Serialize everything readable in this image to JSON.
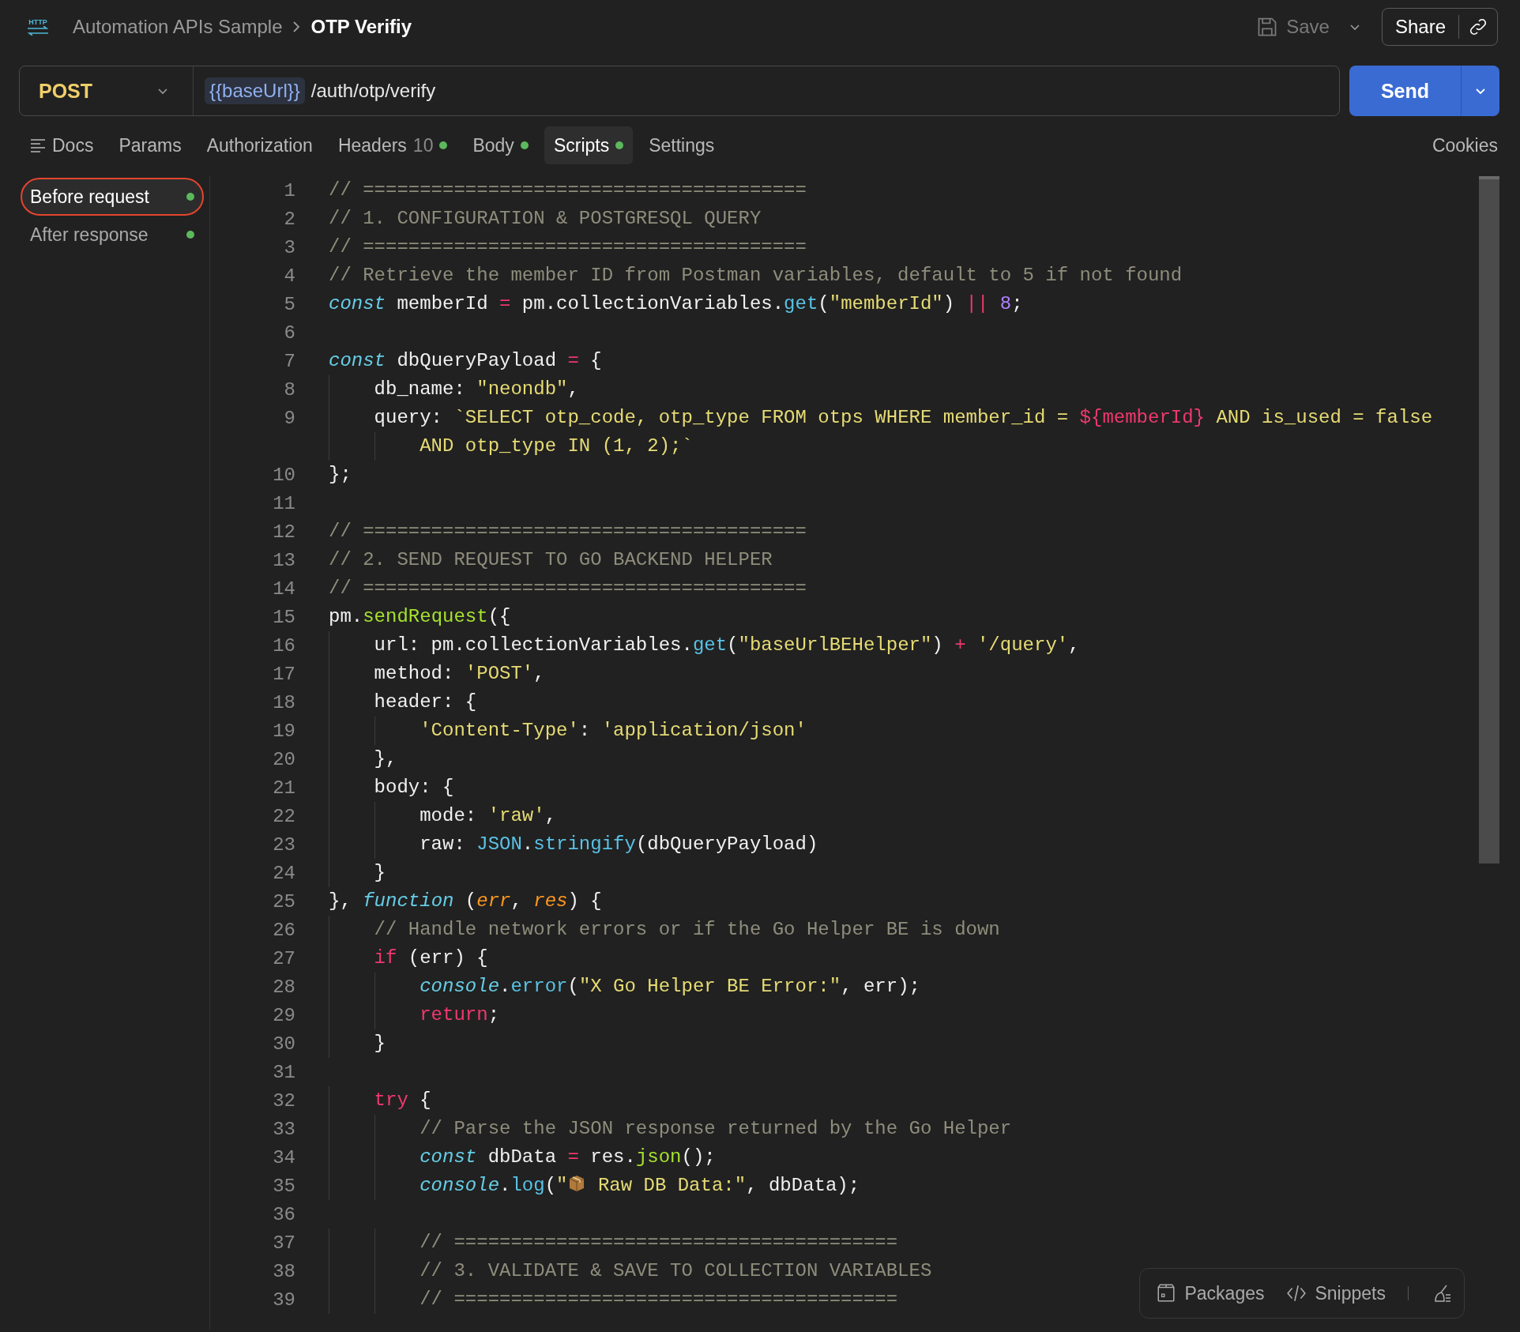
{
  "header": {
    "icon_label": "HTTP",
    "breadcrumb": [
      {
        "label": "Automation APIs Sample",
        "current": false
      },
      {
        "label": "OTP Verifiy",
        "current": true
      }
    ],
    "save": {
      "label": "Save",
      "disabled": true
    },
    "share": {
      "label": "Share"
    }
  },
  "request": {
    "method": "POST",
    "variable": "{{baseUrl}}",
    "path": "/auth/otp/verify",
    "send": "Send"
  },
  "tabs": [
    {
      "label": "Docs",
      "kind": "docs",
      "selected": false,
      "dot": false
    },
    {
      "label": "Params",
      "kind": "plain",
      "selected": false,
      "dot": false
    },
    {
      "label": "Authorization",
      "kind": "plain",
      "selected": false,
      "dot": false
    },
    {
      "label": "Headers",
      "kind": "plain",
      "count": "10",
      "selected": false,
      "dot": true
    },
    {
      "label": "Body",
      "kind": "plain",
      "selected": false,
      "dot": true
    },
    {
      "label": "Scripts",
      "kind": "plain",
      "selected": true,
      "dot": true
    },
    {
      "label": "Settings",
      "kind": "plain",
      "selected": false,
      "dot": false
    }
  ],
  "cookies": "Cookies",
  "script_tabs": [
    {
      "label": "Before request",
      "selected": true,
      "dot": true
    },
    {
      "label": "After response",
      "selected": false,
      "dot": true
    }
  ],
  "editor": {
    "lines": [
      {
        "number": "1",
        "tokens": [
          {
            "kind": "c",
            "text": "// ======================================="
          }
        ]
      },
      {
        "number": "2",
        "tokens": [
          {
            "kind": "c",
            "text": "// 1. CONFIGURATION & POSTGRESQL QUERY"
          }
        ]
      },
      {
        "number": "3",
        "tokens": [
          {
            "kind": "c",
            "text": "// ======================================="
          }
        ]
      },
      {
        "number": "4",
        "tokens": [
          {
            "kind": "c",
            "text": "// Retrieve the member ID from Postman variables, default to 5 if not found"
          }
        ]
      },
      {
        "number": "5",
        "tokens": [
          {
            "kind": "s",
            "text": "const"
          },
          {
            "kind": "p",
            "text": " memberId "
          },
          {
            "kind": "o",
            "text": "="
          },
          {
            "kind": "p",
            "text": " pm.collectionVariables."
          },
          {
            "kind": "f",
            "text": "get"
          },
          {
            "kind": "p",
            "text": "("
          },
          {
            "kind": "str",
            "text": "\"memberId\""
          },
          {
            "kind": "p",
            "text": ")"
          },
          {
            "kind": "o",
            "text": " || "
          },
          {
            "kind": "n",
            "text": "8"
          },
          {
            "kind": "p",
            "text": ";"
          }
        ]
      },
      {
        "number": "6"
      },
      {
        "number": "7",
        "tokens": [
          {
            "kind": "s",
            "text": "const"
          },
          {
            "kind": "p",
            "text": " dbQueryPayload "
          },
          {
            "kind": "o",
            "text": "="
          },
          {
            "kind": "p",
            "text": " {"
          }
        ]
      },
      {
        "number": "8",
        "tokens": [
          {
            "kind": "p",
            "text": "    db_name: "
          },
          {
            "kind": "str",
            "text": "\"neondb\""
          },
          {
            "kind": "p",
            "text": ","
          }
        ]
      },
      {
        "number": "9",
        "tokens": [
          {
            "kind": "p",
            "text": "    query: "
          },
          {
            "kind": "str",
            "text": "`SELECT otp_code, otp_type FROM otps WHERE member_id = "
          },
          {
            "kind": "o",
            "text": "${memberId}"
          },
          {
            "kind": "str",
            "text": " AND is_used = false"
          }
        ],
        "continued": [
          {
            "kind": "str",
            "text": "        AND otp_type IN (1, 2);`"
          }
        ]
      },
      {
        "number": "10",
        "tokens": [
          {
            "kind": "p",
            "text": "};"
          }
        ]
      },
      {
        "number": "11"
      },
      {
        "number": "12",
        "tokens": [
          {
            "kind": "c",
            "text": "// ======================================="
          }
        ]
      },
      {
        "number": "13",
        "tokens": [
          {
            "kind": "c",
            "text": "// 2. SEND REQUEST TO GO BACKEND HELPER"
          }
        ]
      },
      {
        "number": "14",
        "tokens": [
          {
            "kind": "c",
            "text": "// ======================================="
          }
        ]
      },
      {
        "number": "15",
        "tokens": [
          {
            "kind": "p",
            "text": "pm."
          },
          {
            "kind": "g",
            "text": "sendRequest"
          },
          {
            "kind": "p",
            "text": "({"
          }
        ]
      },
      {
        "number": "16",
        "tokens": [
          {
            "kind": "p",
            "text": "    url: pm.collectionVariables."
          },
          {
            "kind": "f",
            "text": "get"
          },
          {
            "kind": "p",
            "text": "("
          },
          {
            "kind": "str",
            "text": "\"baseUrlBEHelper\""
          },
          {
            "kind": "p",
            "text": ")"
          },
          {
            "kind": "o",
            "text": " + "
          },
          {
            "kind": "str",
            "text": "'/query'"
          },
          {
            "kind": "p",
            "text": ","
          }
        ]
      },
      {
        "number": "17",
        "tokens": [
          {
            "kind": "p",
            "text": "    method: "
          },
          {
            "kind": "str",
            "text": "'POST'"
          },
          {
            "kind": "p",
            "text": ","
          }
        ]
      },
      {
        "number": "18",
        "tokens": [
          {
            "kind": "p",
            "text": "    header: {"
          }
        ]
      },
      {
        "number": "19",
        "tokens": [
          {
            "kind": "str",
            "text": "        'Content-Type'"
          },
          {
            "kind": "p",
            "text": ": "
          },
          {
            "kind": "str",
            "text": "'application/json'"
          }
        ]
      },
      {
        "number": "20",
        "tokens": [
          {
            "kind": "p",
            "text": "    },"
          }
        ]
      },
      {
        "number": "21",
        "tokens": [
          {
            "kind": "p",
            "text": "    body: {"
          }
        ]
      },
      {
        "number": "22",
        "tokens": [
          {
            "kind": "p",
            "text": "        mode: "
          },
          {
            "kind": "str",
            "text": "'raw'"
          },
          {
            "kind": "p",
            "text": ","
          }
        ]
      },
      {
        "number": "23",
        "tokens": [
          {
            "kind": "p",
            "text": "        raw: "
          },
          {
            "kind": "f",
            "text": "JSON"
          },
          {
            "kind": "p",
            "text": "."
          },
          {
            "kind": "f",
            "text": "stringify"
          },
          {
            "kind": "p",
            "text": "(dbQueryPayload)"
          }
        ]
      },
      {
        "number": "24",
        "tokens": [
          {
            "kind": "p",
            "text": "    }"
          }
        ]
      },
      {
        "number": "25",
        "tokens": [
          {
            "kind": "p",
            "text": "}, "
          },
          {
            "kind": "s",
            "text": "function"
          },
          {
            "kind": "p",
            "text": " ("
          },
          {
            "kind": "a",
            "text": "err"
          },
          {
            "kind": "p",
            "text": ", "
          },
          {
            "kind": "a",
            "text": "res"
          },
          {
            "kind": "p",
            "text": ") {"
          }
        ]
      },
      {
        "number": "26",
        "tokens": [
          {
            "kind": "c",
            "text": "    // Handle network errors or if the Go Helper BE is down"
          }
        ]
      },
      {
        "number": "27",
        "tokens": [
          {
            "kind": "k",
            "text": "    if"
          },
          {
            "kind": "p",
            "text": " (err) {"
          }
        ]
      },
      {
        "number": "28",
        "tokens": [
          {
            "kind": "i",
            "text": "        console"
          },
          {
            "kind": "p",
            "text": "."
          },
          {
            "kind": "f",
            "text": "error"
          },
          {
            "kind": "p",
            "text": "("
          },
          {
            "kind": "str",
            "text": "\"X Go Helper BE Error:\""
          },
          {
            "kind": "p",
            "text": ", err);"
          }
        ]
      },
      {
        "number": "29",
        "tokens": [
          {
            "kind": "k",
            "text": "        return"
          },
          {
            "kind": "p",
            "text": ";"
          }
        ]
      },
      {
        "number": "30",
        "tokens": [
          {
            "kind": "p",
            "text": "    }"
          }
        ]
      },
      {
        "number": "31"
      },
      {
        "number": "32",
        "tokens": [
          {
            "kind": "k",
            "text": "    try"
          },
          {
            "kind": "p",
            "text": " {"
          }
        ]
      },
      {
        "number": "33",
        "tokens": [
          {
            "kind": "c",
            "text": "        // Parse the JSON response returned by the Go Helper"
          }
        ]
      },
      {
        "number": "34",
        "tokens": [
          {
            "kind": "s",
            "text": "        const"
          },
          {
            "kind": "p",
            "text": " dbData "
          },
          {
            "kind": "o",
            "text": "="
          },
          {
            "kind": "p",
            "text": " res."
          },
          {
            "kind": "g",
            "text": "json"
          },
          {
            "kind": "p",
            "text": "();"
          }
        ]
      },
      {
        "number": "35",
        "tokens": [
          {
            "kind": "i",
            "text": "        console"
          },
          {
            "kind": "p",
            "text": "."
          },
          {
            "kind": "f",
            "text": "log"
          },
          {
            "kind": "p",
            "text": "("
          },
          {
            "kind": "str",
            "text": "\""
          },
          {
            "kind": "box"
          },
          {
            "kind": "str",
            "text": " Raw DB Data:\""
          },
          {
            "kind": "p",
            "text": ", dbData);"
          }
        ]
      },
      {
        "number": "36"
      },
      {
        "number": "37",
        "tokens": [
          {
            "kind": "c",
            "text": "        // ======================================="
          }
        ]
      },
      {
        "number": "38",
        "tokens": [
          {
            "kind": "c",
            "text": "        // 3. VALIDATE & SAVE TO COLLECTION VARIABLES"
          }
        ]
      },
      {
        "number": "39",
        "tokens": [
          {
            "kind": "c",
            "text": "        // ======================================="
          }
        ]
      }
    ]
  },
  "toolbar": [
    {
      "kind": "packages",
      "label": "Packages"
    },
    {
      "kind": "snippets",
      "label": "Snippets"
    },
    {
      "kind": "clean"
    }
  ]
}
